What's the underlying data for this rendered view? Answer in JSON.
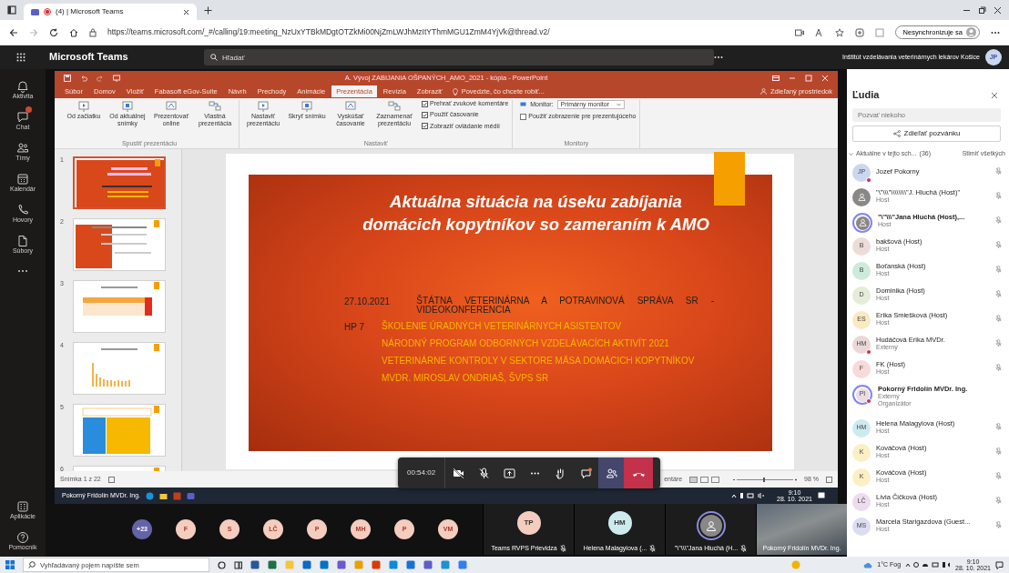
{
  "browser": {
    "tab_title": "(4) | Microsoft Teams",
    "url": "https://teams.microsoft.com/_#/calling/19:meeting_NzUxYTBkMDgtOTZkMi00NjZmLWJhMzItYThmMGU1ZmM4YjVk@thread.v2/",
    "sync_button": "Nesynchronizuje sa"
  },
  "teams_header": {
    "app_name": "Microsoft Teams",
    "search_placeholder": "Hľadať",
    "organization": "Inštitút vzdelávania veterinárnych lekárov Košice",
    "avatar": "JP"
  },
  "rail": {
    "items": [
      {
        "label": "Aktivita",
        "kind": "bell",
        "notification": false
      },
      {
        "label": "Chat",
        "kind": "chat",
        "notification": true
      },
      {
        "label": "Tímy",
        "kind": "teams",
        "notification": false
      },
      {
        "label": "Kalendár",
        "kind": "calendar",
        "notification": false
      },
      {
        "label": "Hovory",
        "kind": "phone",
        "notification": false
      },
      {
        "label": "Súbory",
        "kind": "file",
        "notification": false
      }
    ],
    "bottom": [
      {
        "label": "Aplikácie",
        "kind": "apps"
      },
      {
        "label": "Pomocník",
        "kind": "help"
      }
    ]
  },
  "powerpoint": {
    "title": "A. Vývoj ZABIJANIA OŠPANÝCH_AMO_2021 - kópia - PowerPoint",
    "tabs": [
      {
        "label": "Súbor",
        "selected": false
      },
      {
        "label": "Domov",
        "selected": false
      },
      {
        "label": "Vložiť",
        "selected": false
      },
      {
        "label": "Fabasoft eGov-Suite",
        "selected": false
      },
      {
        "label": "Návrh",
        "selected": false
      },
      {
        "label": "Prechody",
        "selected": false
      },
      {
        "label": "Animácie",
        "selected": false
      },
      {
        "label": "Prezentácia",
        "selected": true
      },
      {
        "label": "Revízia",
        "selected": false
      },
      {
        "label": "Zobraziť",
        "selected": false
      }
    ],
    "tell_me": "Povedzte, čo chcete robiť...",
    "shared_label": "Zdieľaný prostriedok",
    "ribbon_groups": [
      {
        "label": "Spustiť prezentáciu",
        "items": [
          {
            "kind": "button",
            "label": "Od začiatku"
          },
          {
            "kind": "button",
            "label": "Od aktuálnej snímky"
          },
          {
            "kind": "button",
            "label": "Prezentovať online"
          },
          {
            "kind": "button",
            "label": "Vlastná prezentácia"
          }
        ]
      },
      {
        "label": "Nastaviť",
        "items": [
          {
            "kind": "button",
            "label": "Nastaviť prezentáciu"
          },
          {
            "kind": "button",
            "label": "Skryť snímku"
          },
          {
            "kind": "button",
            "label": "Vyskúšať časovanie"
          },
          {
            "kind": "button",
            "label": "Zaznamenať prezentáciu"
          },
          {
            "kind": "checkbox",
            "label": "Prehrať zvukové komentáre",
            "checked": true
          },
          {
            "kind": "checkbox",
            "label": "Použiť časovanie",
            "checked": true
          },
          {
            "kind": "checkbox",
            "label": "Zobraziť ovládanie médií",
            "checked": true
          }
        ]
      },
      {
        "label": "Monitory",
        "items": [
          {
            "kind": "select",
            "label": "Monitor:",
            "value": "Primárny monitor"
          },
          {
            "kind": "checkbox",
            "label": "Použiť zobrazenie pre prezentujúceho",
            "checked": false
          }
        ]
      }
    ],
    "thumbnails": [
      {
        "number": "1",
        "kind": "title",
        "selected": true
      },
      {
        "number": "2",
        "kind": "text",
        "selected": false
      },
      {
        "number": "3",
        "kind": "table",
        "selected": false
      },
      {
        "number": "4",
        "kind": "chart",
        "selected": false
      },
      {
        "number": "5",
        "kind": "color-table",
        "selected": false
      },
      {
        "number": "6",
        "kind": "text",
        "selected": false
      }
    ],
    "slide": {
      "title": "Aktuálna situácia na úseku zabíjania domácich kopytníkov so zameraním k AMO",
      "date": "27.10.2021",
      "organizer": "ŠTÁTNA VETERINÁRNA A POTRAVINOVÁ SPRÁVA SR - VIDEOKONFERENCIA",
      "code": "HP 7",
      "lines": [
        "ŠKOLENIE ÚRADNÝCH VETERINÁRNYCH ASISTENTOV",
        "NÁRODNÝ PROGRAM ODBORNÝCH VZDELÁVACÍCH AKTIVÍT 2021",
        "VETERINÁRNE KONTROLY V SEKTORE MÄSA DOMÁCICH KOPYTNÍKOV",
        "MVDR. MIROSLAV ONDRIAŠ, ŠVPS SR"
      ]
    },
    "status_bar": {
      "slide_count": "Snímka 1 z 22",
      "notes": "entáre",
      "zoom": "98 %"
    }
  },
  "remote_taskbar": {
    "presenter": "Pokorný Fridolín MVDr. Ing.",
    "time": "9:10",
    "date": "28. 10. 2021"
  },
  "call_controls": {
    "timer": "00:54:02",
    "buttons": [
      {
        "kind": "camera",
        "selected": false
      },
      {
        "kind": "mic",
        "selected": false
      },
      {
        "kind": "share",
        "selected": false
      },
      {
        "kind": "more",
        "selected": false
      },
      {
        "kind": "hand",
        "selected": false
      },
      {
        "kind": "chat",
        "selected": false
      },
      {
        "kind": "people",
        "selected": true
      },
      {
        "kind": "hangup",
        "selected": false
      }
    ]
  },
  "participant_strip": {
    "avatars": [
      {
        "initials": "+23",
        "kind": "overflow"
      },
      {
        "initials": "F",
        "kind": "person"
      },
      {
        "initials": "S",
        "kind": "person"
      },
      {
        "initials": "LČ",
        "kind": "person"
      },
      {
        "initials": "P",
        "kind": "person"
      },
      {
        "initials": "MH",
        "kind": "person"
      },
      {
        "initials": "P",
        "kind": "person"
      },
      {
        "initials": "VM",
        "kind": "person"
      }
    ],
    "tiles": [
      {
        "kind": "avatar",
        "initials": "TP",
        "color": "#f4cdbf",
        "name": "Teams RVPS Prievidza",
        "muted": true,
        "highlighted": false
      },
      {
        "kind": "avatar",
        "initials": "HM",
        "color": "#cdebee",
        "name": "Helena Malagyiova (...",
        "muted": true,
        "highlighted": false
      },
      {
        "kind": "silhouette",
        "name": "\"\\\"\\\\\\\"Jana Hluchá (H...",
        "muted": true,
        "highlighted": true
      },
      {
        "kind": "video",
        "name": "Pokorný Fridolín MVDr. Ing.",
        "muted": false
      }
    ]
  },
  "people_panel": {
    "title": "Ľudia",
    "invite_placeholder": "Pozvať niekoho",
    "share_button": "Zdieľať pozvánku",
    "section_label": "Aktuálne v tejto sch...",
    "section_count": "(36)",
    "section_expanded": true,
    "mute_all": "Stlmiť všetkých",
    "people": [
      {
        "name": "Jozef Pokorny",
        "kind": "initials",
        "initials": "JP",
        "color": "#c9d8ee",
        "busy": true,
        "muted": true,
        "highlighted": false
      },
      {
        "name": "\"\\\"\\\\\\\"\\\\\\\\\\\\\\\\\"J. Hluchá (Host)\"",
        "subtitles": [
          "Host"
        ],
        "kind": "silhouette",
        "color": "#8a8886",
        "busy": false,
        "muted": true,
        "highlighted": false
      },
      {
        "name": "\"\\\"\\\\\\\"Jana Hluchá (Host),...",
        "subtitles": [
          "Host"
        ],
        "kind": "silhouette",
        "color": "#8a8886",
        "busy": false,
        "muted": true,
        "highlighted": true
      },
      {
        "name": "bakšová (Host)",
        "subtitles": [
          "Host"
        ],
        "kind": "initials",
        "initials": "B",
        "color": "#ecdcd8",
        "busy": false,
        "muted": true,
        "highlighted": false
      },
      {
        "name": "Boťanská (Host)",
        "subtitles": [
          "Host"
        ],
        "kind": "initials",
        "initials": "B",
        "color": "#cdebdc",
        "busy": false,
        "muted": true,
        "highlighted": false
      },
      {
        "name": "Dominika (Host)",
        "subtitles": [
          "Host"
        ],
        "kind": "initials",
        "initials": "D",
        "color": "#e6ecd8",
        "busy": false,
        "muted": true,
        "highlighted": false
      },
      {
        "name": "Erika Smiešková (Host)",
        "subtitles": [
          "Host"
        ],
        "kind": "initials",
        "initials": "ES",
        "color": "#fbe9c1",
        "busy": false,
        "muted": true,
        "highlighted": false
      },
      {
        "name": "Hudáčová Erika MVDr.",
        "subtitles": [
          "Externý"
        ],
        "kind": "initials",
        "initials": "HM",
        "color": "#ead8d6",
        "busy": true,
        "muted": true,
        "highlighted": false
      },
      {
        "name": "FK (Host)",
        "subtitles": [
          "Host"
        ],
        "kind": "initials",
        "initials": "F",
        "color": "#f9dada",
        "busy": false,
        "muted": true,
        "highlighted": false
      },
      {
        "name": "Pokorný Fridolín MVDr. Ing.",
        "subtitles": [
          "Externý",
          "Organizátor"
        ],
        "kind": "initials",
        "initials": "PI",
        "color": "#eadbe4",
        "busy": true,
        "muted": false,
        "highlighted": true
      },
      {
        "name": "Helena Malagyiova (Host)",
        "subtitles": [
          "Host"
        ],
        "kind": "initials",
        "initials": "HM",
        "color": "#cdebee",
        "busy": false,
        "muted": true,
        "highlighted": false
      },
      {
        "name": "Kováčová (Host)",
        "subtitles": [
          "Host"
        ],
        "kind": "initials",
        "initials": "K",
        "color": "#fcefc4",
        "busy": false,
        "muted": true,
        "highlighted": false
      },
      {
        "name": "Kováčová (Host)",
        "subtitles": [
          "Host"
        ],
        "kind": "initials",
        "initials": "K",
        "color": "#fcefc4",
        "busy": false,
        "muted": true,
        "highlighted": false
      },
      {
        "name": "Lívia Čičková (Host)",
        "subtitles": [
          "Host"
        ],
        "kind": "initials",
        "initials": "LČ",
        "color": "#eddbee",
        "busy": false,
        "muted": true,
        "highlighted": false
      },
      {
        "name": "Marcela Starigazdova (Guest...",
        "subtitles": [
          "Host"
        ],
        "kind": "initials",
        "initials": "MS",
        "color": "#dcdcf2",
        "busy": false,
        "muted": true,
        "highlighted": false
      }
    ]
  },
  "taskbar": {
    "search_placeholder": "Vyhľadávaný pojem napíšte sem",
    "weather": "1°C Fog",
    "time": "9:10",
    "date": "28. 10. 2021"
  }
}
